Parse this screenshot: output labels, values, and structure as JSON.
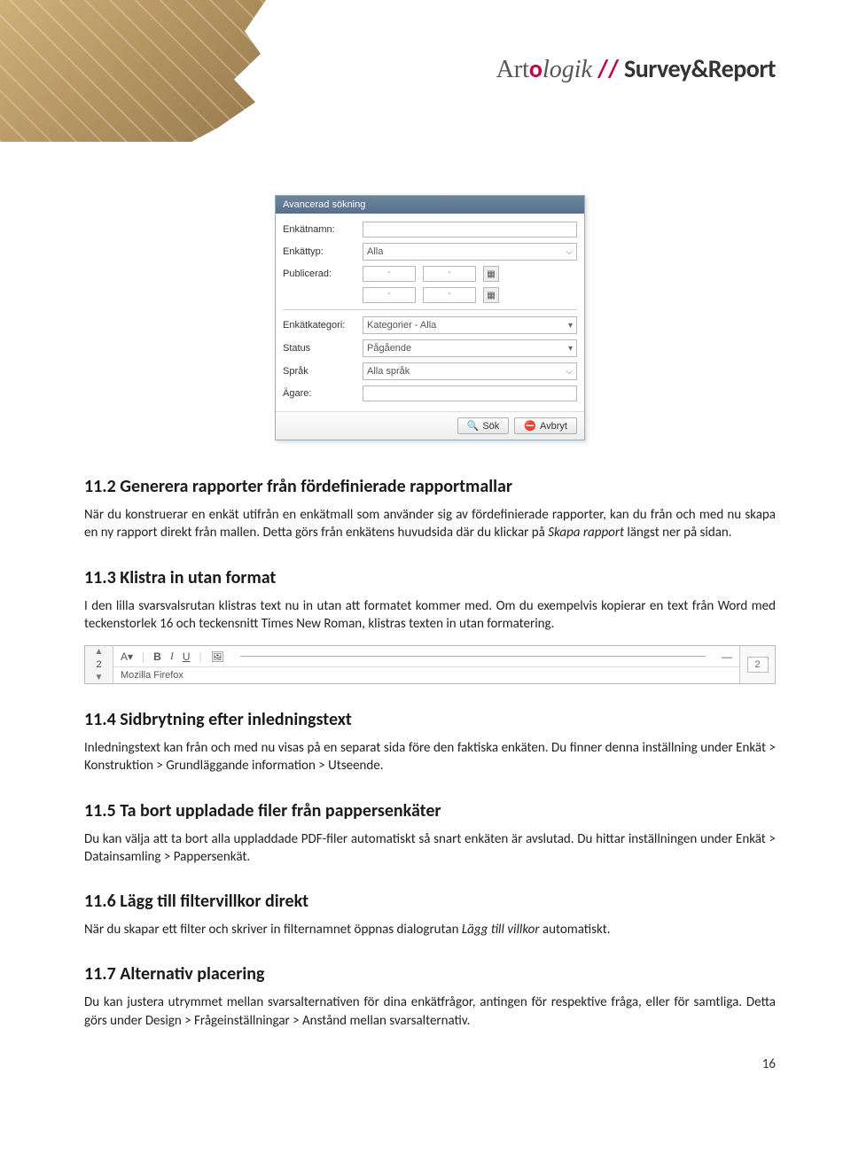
{
  "header": {
    "brand_art": "Art",
    "brand_o": "o",
    "brand_logik": "logik",
    "brand_slashes": "//",
    "brand_product": "Survey&Report"
  },
  "adv_search": {
    "title": "Avancerad sökning",
    "rows": {
      "name_label": "Enkätnamn:",
      "type_label": "Enkättyp:",
      "type_value": "Alla",
      "published_label": "Publicerad:",
      "date_placeholder": "-",
      "category_label": "Enkätkategori:",
      "category_value": "Kategorier - Alla",
      "status_label": "Status",
      "status_value": "Pågående",
      "lang_label": "Språk",
      "lang_value": "Alla språk",
      "owner_label": "Ägare:"
    },
    "buttons": {
      "search": "Sök",
      "cancel": "Avbryt"
    }
  },
  "sections": {
    "s112_h": "11.2 Generera rapporter från fördefinierade rapportmallar",
    "s112_p1": "När du konstruerar en enkät utifrån en enkätmall som använder sig av fördefinierade rapporter, kan du från och med nu skapa en ny rapport direkt från mallen. Detta görs från enkätens huvudsida där du klickar på ",
    "s112_p1_em": "Skapa rapport",
    "s112_p1_tail": " längst ner på sidan.",
    "s113_h": "11.3 Klistra in utan format",
    "s113_p": "I den lilla svarsvalsrutan klistras text nu in utan att formatet kommer med. Om du exempelvis kopierar en text från Word med teckenstorlek 16 och teckensnitt Times New Roman, klistras texten in utan formatering.",
    "s114_h": "11.4 Sidbrytning efter inledningstext",
    "s114_p": "Inledningstext kan från och med nu visas på en separat sida före den faktiska enkäten. Du finner denna inställning under Enkät > Konstruktion > Grundläggande information > Utseende.",
    "s115_h": "11.5 Ta bort uppladade filer från pappersenkäter",
    "s115_p": "Du kan välja att ta bort alla uppladdade PDF-filer automatiskt så snart enkäten är avslutad. Du hittar inställningen under Enkät > Datainsamling > Pappersenkät.",
    "s116_h": "11.6 Lägg till filtervillkor direkt",
    "s116_p1": "När du skapar ett filter och skriver in filternamnet öppnas dialogrutan ",
    "s116_p1_em": "Lägg till villkor",
    "s116_p1_tail": " automatiskt.",
    "s117_h": "11.7 Alternativ placering",
    "s117_p": "Du kan justera utrymmet mellan svarsalternativen för dina enkätfrågor, antingen för respektive fråga, eller för samtliga. Detta görs under Design > Frågeinställningar > Anstånd mellan svarsalternativ."
  },
  "editor": {
    "index": "2",
    "font_label": "A",
    "btn_bold": "B",
    "btn_italic": "I",
    "btn_underline": "U",
    "row2": "Mozilla Firefox",
    "right_box": "2"
  },
  "page_number": "16"
}
